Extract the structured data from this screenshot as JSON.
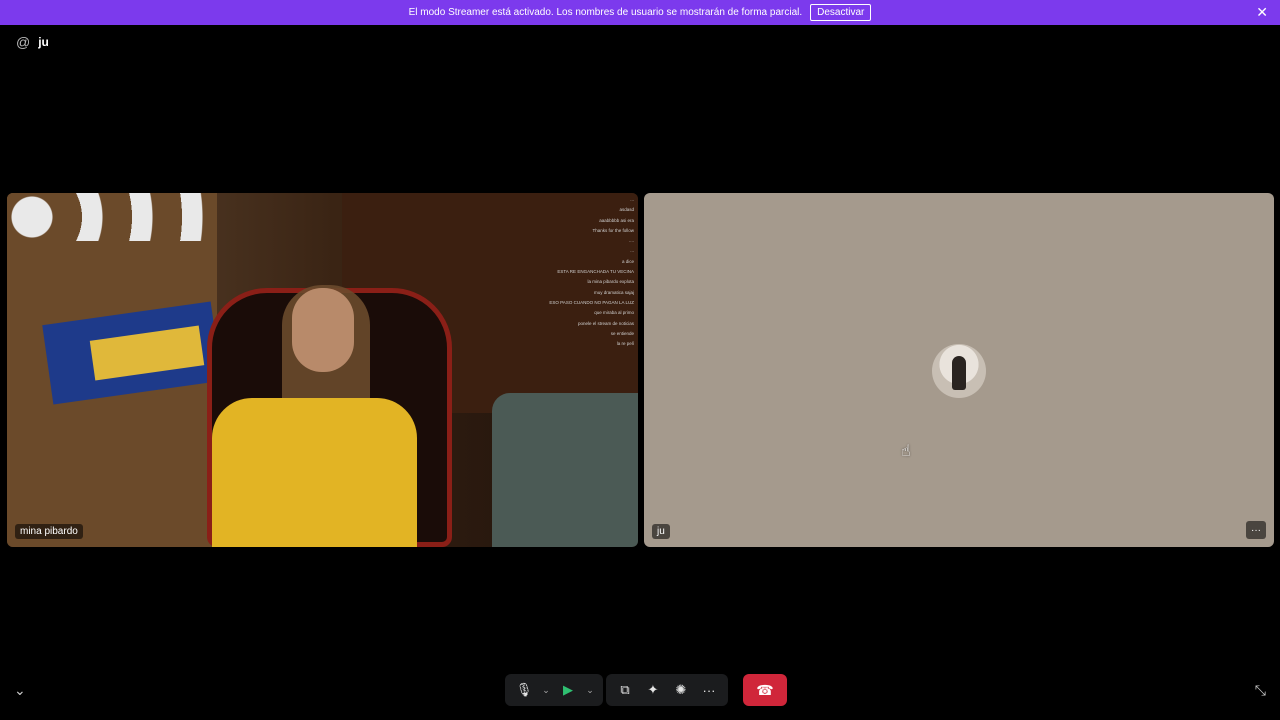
{
  "banner": {
    "message": "El modo Streamer está activado. Los nombres de usuario se mostrarán de forma parcial.",
    "action_label": "Desactivar",
    "close_glyph": "✕",
    "bg_color": "#7c3aed"
  },
  "header": {
    "at_glyph": "@",
    "channel_name": "ju"
  },
  "tiles": {
    "left": {
      "participant_name": "mina pibardo",
      "chat_lines": [
        "...",
        "asdasd",
        "aaabbbbb asi era",
        "Thanks for the follow",
        "....",
        "...",
        "a dice",
        "ESTA RE ENGANCHADA TU VECINA",
        "la mina pibardo explota",
        "muy dramatica sajaj",
        "ESO PASO CUANDO NO PAGAN LA LUZ",
        "que miraba al primo",
        "ponele el stream de noticias",
        "se entiende",
        "la re pelí"
      ]
    },
    "right": {
      "participant_name": "ju",
      "more_glyph": "···"
    }
  },
  "controls": {
    "collapse_glyph": "⌄",
    "mic_glyph": "🎙",
    "camera_glyph": "▶",
    "dropdown_glyph": "⌄",
    "screen_share_glyph": "⧉",
    "activities_glyph": "✦",
    "soundboard_glyph": "✺",
    "more_glyph": "···",
    "hangup_glyph": "☎",
    "fullscreen_exit_glyph": "⤡",
    "hangup_color": "#d0263a",
    "camera_on_color": "#2fbf71"
  }
}
